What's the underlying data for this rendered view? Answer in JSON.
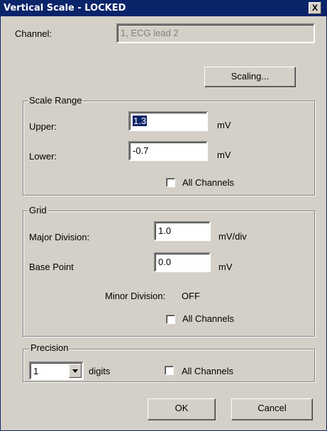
{
  "window": {
    "title": "Vertical Scale - LOCKED",
    "close_symbol": "X"
  },
  "channel": {
    "label": "Channel:",
    "value": "1, ECG lead 2"
  },
  "scaling_button": "Scaling...",
  "scale_range": {
    "title": "Scale Range",
    "upper_label": "Upper:",
    "upper_value": "1.3",
    "upper_unit": "mV",
    "lower_label": "Lower:",
    "lower_value": "-0.7",
    "lower_unit": "mV",
    "all_channels": "All Channels"
  },
  "grid": {
    "title": "Grid",
    "major_label": "Major Division:",
    "major_value": "1.0",
    "major_unit": "mV/div",
    "base_label": "Base Point",
    "base_value": "0.0",
    "base_unit": "mV",
    "minor_label": "Minor Division:",
    "minor_value": "OFF",
    "all_channels": "All Channels"
  },
  "precision": {
    "title": "Precision",
    "value": "1",
    "unit": "digits",
    "all_channels": "All Channels"
  },
  "buttons": {
    "ok": "OK",
    "cancel": "Cancel"
  },
  "icons": {
    "close": "close-icon",
    "dropdown": "chevron-down-icon"
  },
  "colors": {
    "title_bar": "#0a246a",
    "dialog_face": "#d4d0c8",
    "selection": "#0a246a"
  }
}
